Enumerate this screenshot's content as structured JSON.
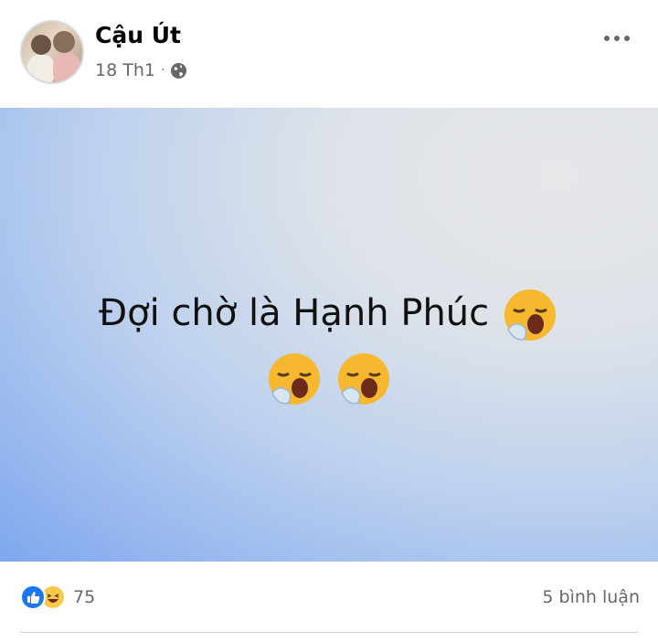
{
  "post": {
    "author": "Cậu Út",
    "date": "18 Th1",
    "separator": "·",
    "image_text_line1": "Đợi chờ là Hạnh Phúc",
    "reaction_count": "75",
    "comments_label": "5 bình luận"
  },
  "icons": {
    "privacy": "globe-icon",
    "more": "more-horizontal-icon",
    "reactions": [
      "like-icon",
      "haha-icon"
    ],
    "emoji": "yawning-face-icon"
  },
  "colors": {
    "like_blue": "#1877f2",
    "haha_yellow": "#f7c84a",
    "secondary_text": "#65676b"
  }
}
